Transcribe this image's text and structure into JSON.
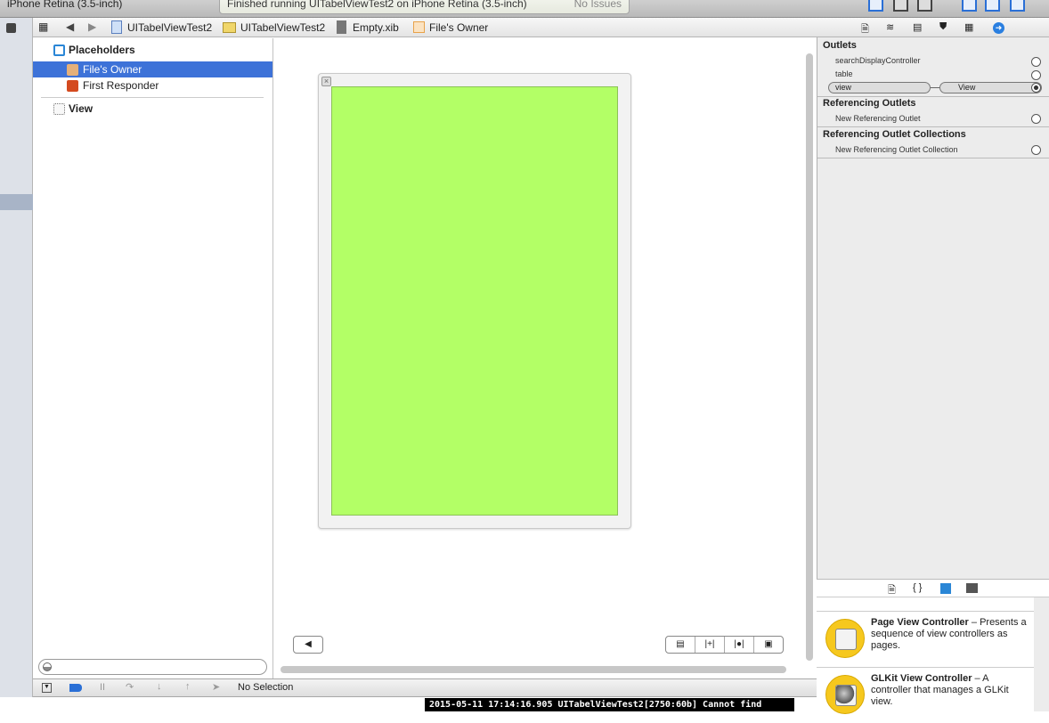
{
  "toolbar": {
    "scheme": "iPhone Retina (3.5-inch)",
    "status": "Finished running UITabelViewTest2 on iPhone Retina (3.5-inch)",
    "issues": "No Issues"
  },
  "jumpbar": {
    "items": [
      "UITabelViewTest2",
      "UITabelViewTest2",
      "Empty.xib",
      "File's Owner"
    ]
  },
  "outline": {
    "placeholders": "Placeholders",
    "files_owner": "File's Owner",
    "first_responder": "First Responder",
    "view": "View"
  },
  "debug": {
    "selection": "No Selection"
  },
  "console": {
    "text": "2015-05-11 17:14:16.905 UITabelViewTest2[2750:60b] Cannot find"
  },
  "canvas": {
    "view_color": "#b3ff66"
  },
  "inspector": {
    "outlets_title": "Outlets",
    "outlets": [
      "searchDisplayController",
      "table"
    ],
    "connected_outlet": "view",
    "connected_target": "View",
    "ref_outlets_title": "Referencing Outlets",
    "new_ref_outlet": "New Referencing Outlet",
    "ref_coll_title": "Referencing Outlet Collections",
    "new_ref_coll": "New Referencing Outlet Collection"
  },
  "library": {
    "items": [
      {
        "title": "Page View Controller",
        "desc": "Presents a sequence of view controllers as pages."
      },
      {
        "title": "GLKit View Controller",
        "desc": "A controller that manages a GLKit view."
      }
    ]
  }
}
